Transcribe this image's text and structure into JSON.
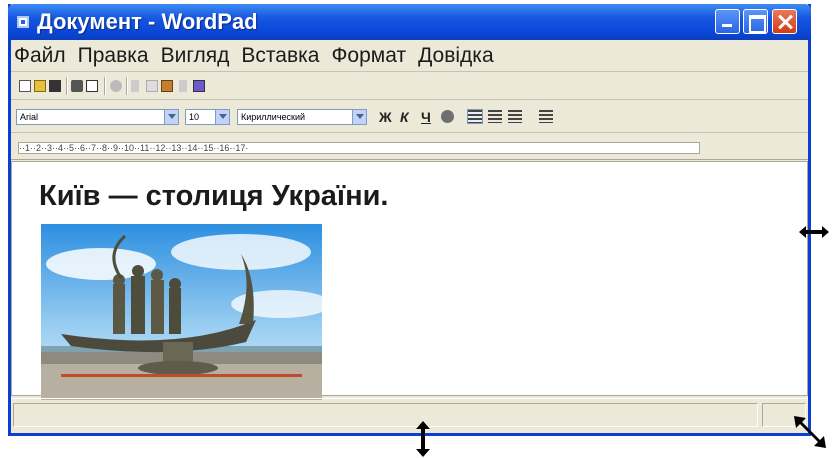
{
  "window": {
    "title": "Документ - WordPad",
    "menu": [
      "Файл",
      "Правка",
      "Вигляд",
      "Вставка",
      "Формат",
      "Довідка"
    ]
  },
  "toolbar": {
    "font_name": "Arial",
    "font_size": "10",
    "script": "Кириллический",
    "bold_label": "Ж",
    "italic_label": "К",
    "underline_label": "Ч"
  },
  "ruler": {
    "marks": "··1··2··3··4··5··6··7··8··9··10··11··12··13··14··15··16··17·"
  },
  "document": {
    "heading": "Київ — столиця України.",
    "image_subject": "monument to the founders of Kyiv"
  },
  "colors": {
    "titlebar": "#0a46d6",
    "window_face": "#ece9d8",
    "close_button": "#d23c14"
  }
}
